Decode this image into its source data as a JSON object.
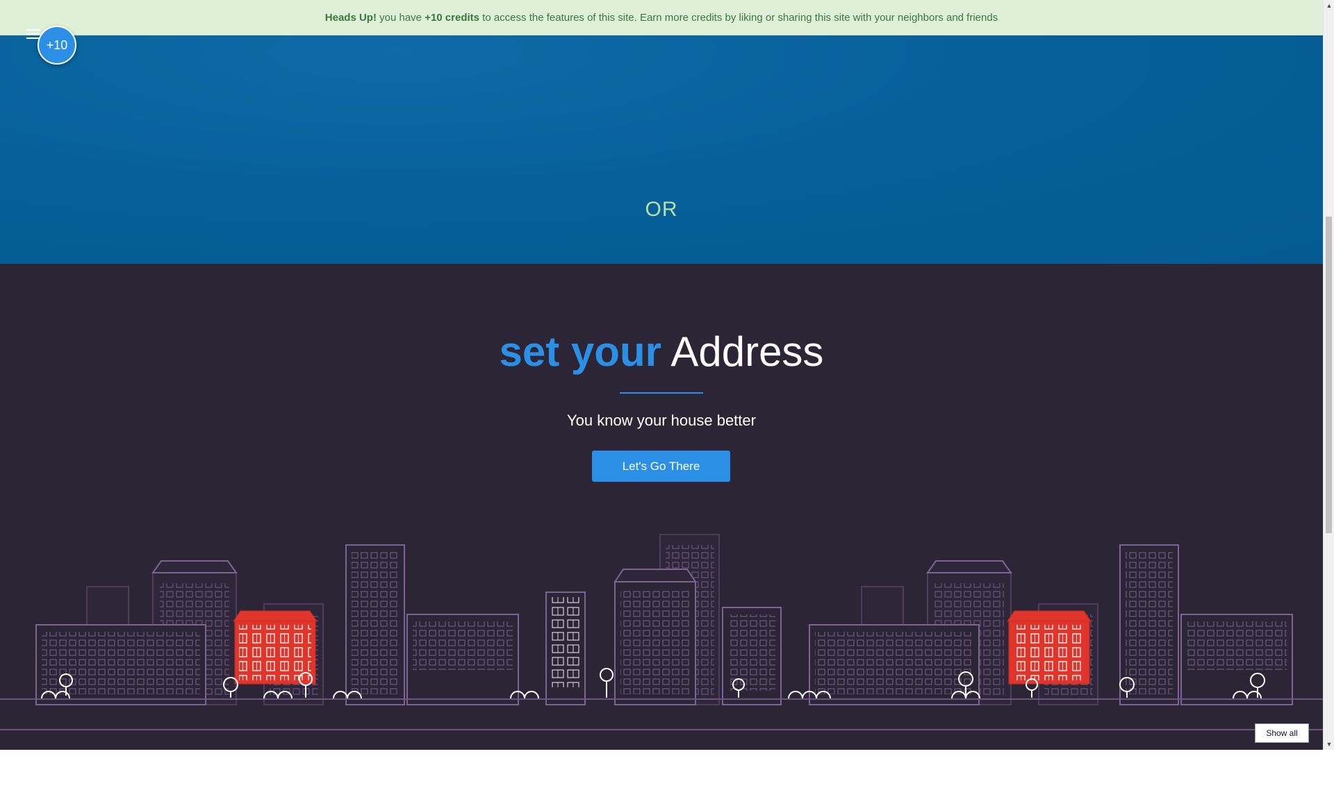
{
  "alert": {
    "lead": "Heads Up!",
    "text1": " you have ",
    "credits": "+10 credits",
    "text2": " to access the features of this site. Earn more credits by liking or sharing this site with your neighbors and friends"
  },
  "credits_badge": "+10",
  "hero": {
    "or": "OR"
  },
  "address": {
    "title_accent": "set your",
    "title_rest": " Address",
    "subtitle": "You know your house better",
    "button": "Let's Go There"
  },
  "download_bar": {
    "show_all": "Show all"
  },
  "colors": {
    "accent": "#2b8fe6",
    "alert_bg": "#dff0d8",
    "alert_text": "#3c763d",
    "hero_bg": "#07609a",
    "dark_bg": "#2c2535",
    "building_line": "#5c4a6e",
    "highlight_house": "#e0352b"
  }
}
